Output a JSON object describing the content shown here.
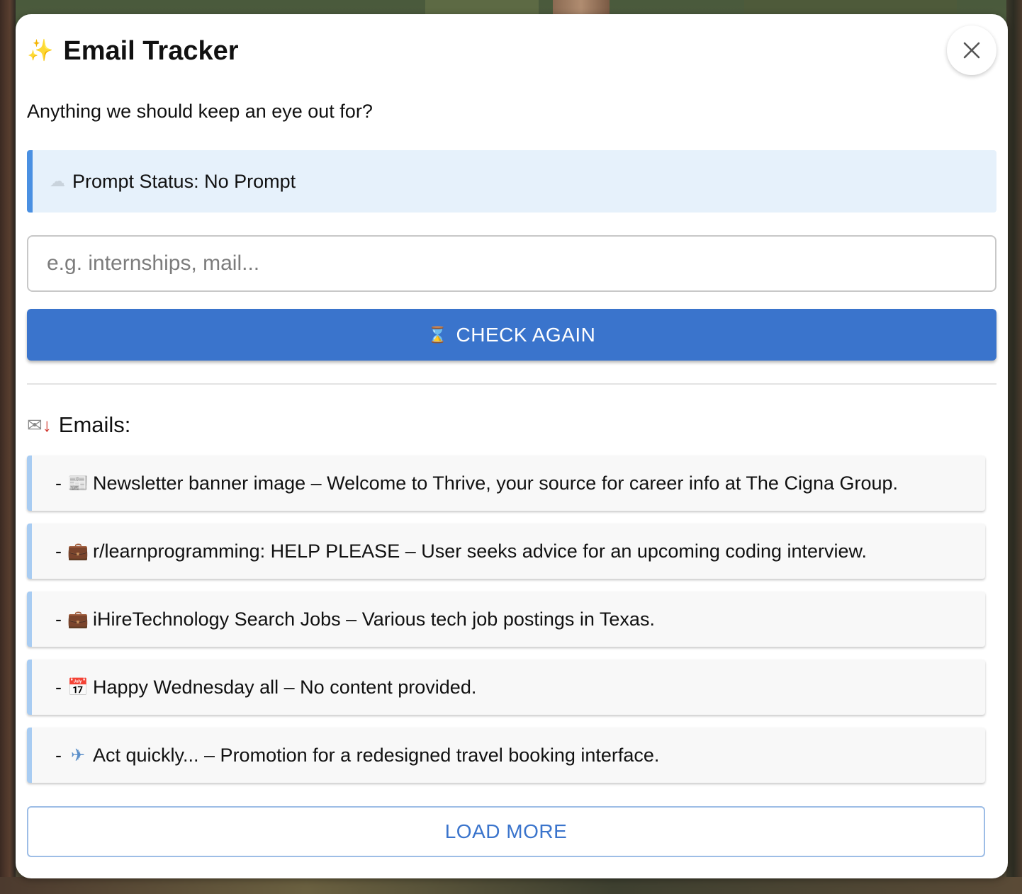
{
  "header": {
    "title": "Email Tracker",
    "icon": "sparkles-icon"
  },
  "subtitle": "Anything we should keep an eye out for?",
  "status": {
    "label": "Prompt Status: No Prompt",
    "icon": "cloud-icon"
  },
  "prompt_input": {
    "value": "",
    "placeholder": "e.g. internships, mail..."
  },
  "check_button": {
    "label": "CHECK AGAIN",
    "icon": "hourglass-icon"
  },
  "emails": {
    "heading": "Emails:",
    "icon": "inbox-tray-icon",
    "items": [
      {
        "icon": "newspaper-icon",
        "glyph": "📰",
        "text": "Newsletter banner image – Welcome to Thrive, your source for career info at The Cigna Group."
      },
      {
        "icon": "briefcase-icon",
        "glyph": "💼",
        "text": "r/learnprogramming: HELP PLEASE – User seeks advice for an upcoming coding interview."
      },
      {
        "icon": "briefcase-icon",
        "glyph": "💼",
        "text": "iHireTechnology Search Jobs – Various tech job postings in Texas."
      },
      {
        "icon": "calendar-icon",
        "glyph": "📅",
        "text": "Happy Wednesday all – No content provided."
      },
      {
        "icon": "airplane-icon",
        "glyph": "✈",
        "text": "Act quickly... – Promotion for a redesigned travel booking interface."
      }
    ]
  },
  "load_more": {
    "label": "LOAD MORE"
  },
  "colors": {
    "primary": "#3a74cc",
    "status_bg": "#e6f1fb",
    "status_border": "#4a90e2",
    "email_accent": "#a8ccf2"
  }
}
